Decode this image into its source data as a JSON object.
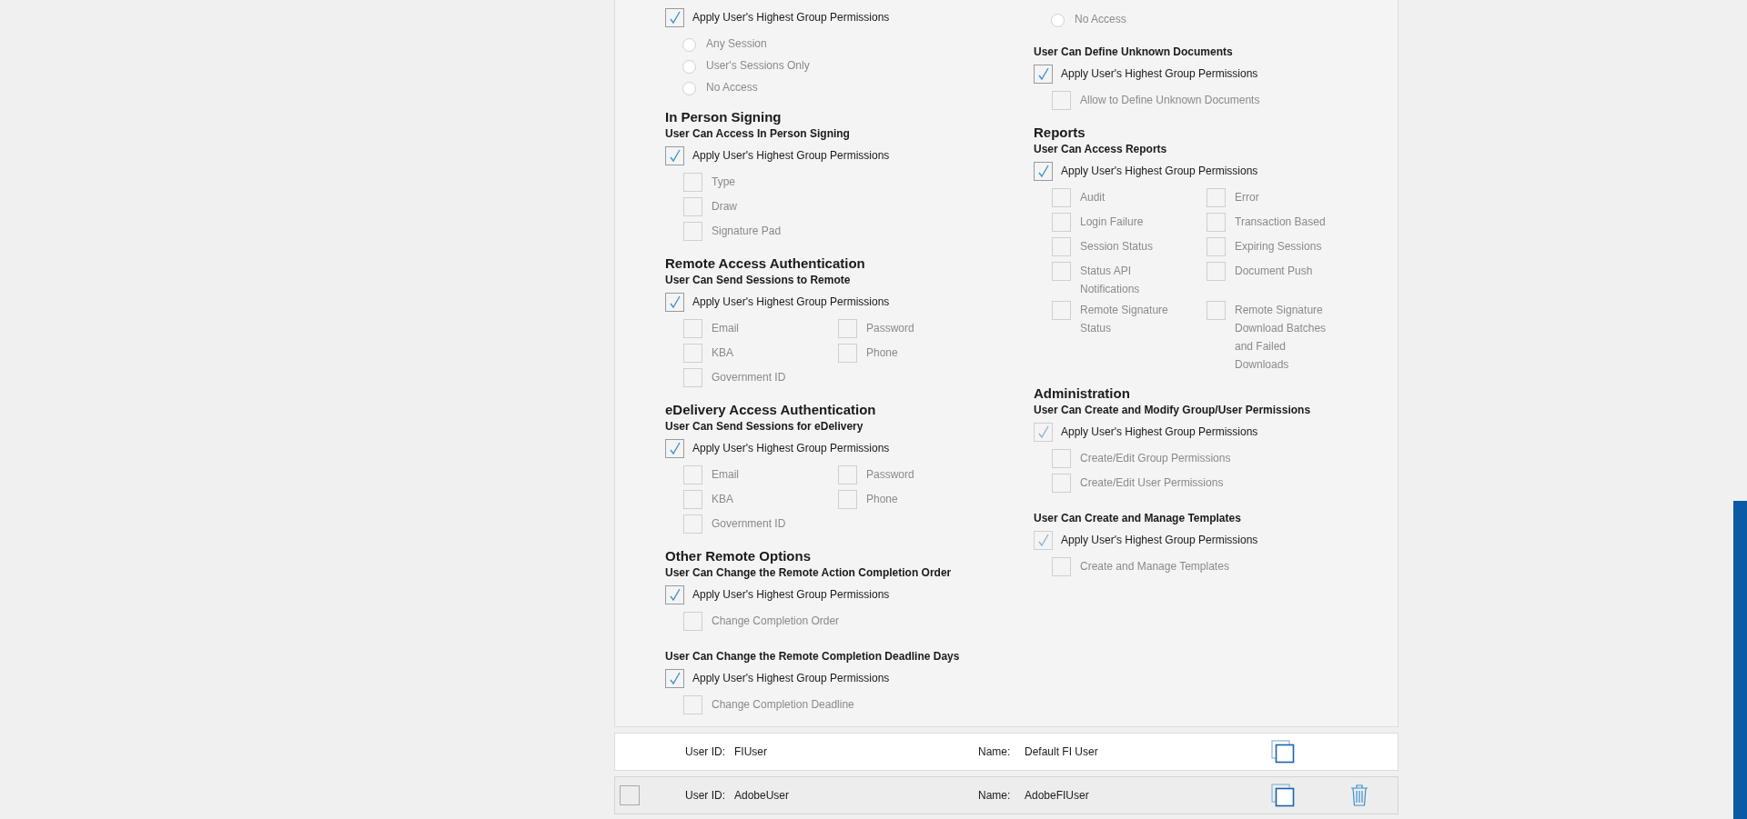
{
  "columns": [
    {
      "items": [
        {
          "kind": "permission",
          "apply": {
            "label": "Apply User's Highest Group Permissions",
            "checked": true,
            "disabled": false
          },
          "options": {
            "kind": "list",
            "items": [
              {
                "kind": "radio",
                "label": "Any Session",
                "selected": false
              },
              {
                "kind": "radio",
                "label": "User's Sessions Only",
                "selected": false
              },
              {
                "kind": "radio",
                "label": "No Access",
                "selected": false
              }
            ]
          }
        },
        {
          "kind": "heading",
          "text": "In Person Signing"
        },
        {
          "kind": "permission",
          "title": "User Can Access In Person Signing",
          "apply": {
            "label": "Apply User's Highest Group Permissions",
            "checked": true,
            "disabled": false
          },
          "options": {
            "kind": "list",
            "items": [
              {
                "kind": "checkbox",
                "label": "Type",
                "checked": false
              },
              {
                "kind": "checkbox",
                "label": "Draw",
                "checked": false
              },
              {
                "kind": "checkbox",
                "label": "Signature Pad",
                "checked": false
              }
            ]
          }
        },
        {
          "kind": "heading",
          "text": "Remote Access Authentication"
        },
        {
          "kind": "permission",
          "title": "User Can Send Sessions to Remote",
          "apply": {
            "label": "Apply User's Highest Group Permissions",
            "checked": true,
            "disabled": false
          },
          "options": {
            "kind": "grid",
            "items": [
              {
                "kind": "checkbox",
                "label": "Email",
                "checked": false
              },
              {
                "kind": "checkbox",
                "label": "Password",
                "checked": false
              },
              {
                "kind": "checkbox",
                "label": "KBA",
                "checked": false
              },
              {
                "kind": "checkbox",
                "label": "Phone",
                "checked": false
              },
              {
                "kind": "checkbox",
                "label": "Government ID",
                "checked": false
              }
            ]
          }
        },
        {
          "kind": "heading",
          "text": "eDelivery Access Authentication"
        },
        {
          "kind": "permission",
          "title": "User Can Send Sessions for eDelivery",
          "apply": {
            "label": "Apply User's Highest Group Permissions",
            "checked": true,
            "disabled": false
          },
          "options": {
            "kind": "grid",
            "items": [
              {
                "kind": "checkbox",
                "label": "Email",
                "checked": false
              },
              {
                "kind": "checkbox",
                "label": "Password",
                "checked": false
              },
              {
                "kind": "checkbox",
                "label": "KBA",
                "checked": false
              },
              {
                "kind": "checkbox",
                "label": "Phone",
                "checked": false
              },
              {
                "kind": "checkbox",
                "label": "Government ID",
                "checked": false
              }
            ]
          }
        },
        {
          "kind": "heading",
          "text": "Other Remote Options"
        },
        {
          "kind": "permission",
          "title": "User Can Change the Remote Action Completion Order",
          "apply": {
            "label": "Apply User's Highest Group Permissions",
            "checked": true,
            "disabled": false
          },
          "options": {
            "kind": "list",
            "items": [
              {
                "kind": "checkbox",
                "label": "Change Completion Order",
                "checked": false
              }
            ]
          }
        },
        {
          "kind": "permission",
          "title": "User Can Change the Remote Completion Deadline Days",
          "apply": {
            "label": "Apply User's Highest Group Permissions",
            "checked": true,
            "disabled": false
          },
          "options": {
            "kind": "list",
            "items": [
              {
                "kind": "checkbox",
                "label": "Change Completion Deadline",
                "checked": false
              }
            ]
          }
        }
      ]
    },
    {
      "items": [
        {
          "kind": "permission",
          "options": {
            "kind": "list",
            "items": [
              {
                "kind": "radio",
                "label": "No Access",
                "selected": false
              }
            ]
          }
        },
        {
          "kind": "permission",
          "title": "User Can Define Unknown Documents",
          "apply": {
            "label": "Apply User's Highest Group Permissions",
            "checked": true,
            "disabled": false
          },
          "options": {
            "kind": "list",
            "items": [
              {
                "kind": "checkbox",
                "label": "Allow to Define Unknown Documents",
                "checked": false
              }
            ]
          }
        },
        {
          "kind": "heading",
          "text": "Reports"
        },
        {
          "kind": "permission",
          "title": "User Can Access Reports",
          "apply": {
            "label": "Apply User's Highest Group Permissions",
            "checked": true,
            "disabled": false
          },
          "options": {
            "kind": "grid",
            "items": [
              {
                "kind": "checkbox",
                "label": "Audit",
                "checked": false
              },
              {
                "kind": "checkbox",
                "label": "Error",
                "checked": false
              },
              {
                "kind": "checkbox",
                "label": "Login Failure",
                "checked": false
              },
              {
                "kind": "checkbox",
                "label": "Transaction Based",
                "checked": false
              },
              {
                "kind": "checkbox",
                "label": "Session Status",
                "checked": false
              },
              {
                "kind": "checkbox",
                "label": "Expiring Sessions",
                "checked": false
              },
              {
                "kind": "checkbox",
                "label": "Status API Notifications",
                "checked": false
              },
              {
                "kind": "checkbox",
                "label": "Document Push",
                "checked": false
              },
              {
                "kind": "checkbox",
                "label": "Remote Signature Status",
                "checked": false
              },
              {
                "kind": "checkbox",
                "label": "Remote Signature Download Batches and Failed Downloads",
                "checked": false
              }
            ]
          }
        },
        {
          "kind": "heading",
          "text": "Administration"
        },
        {
          "kind": "permission",
          "title": "User Can Create and Modify Group/User Permissions",
          "apply": {
            "label": "Apply User's Highest Group Permissions",
            "checked": true,
            "disabled": true
          },
          "options": {
            "kind": "list",
            "items": [
              {
                "kind": "checkbox",
                "label": "Create/Edit Group Permissions",
                "checked": false
              },
              {
                "kind": "checkbox",
                "label": "Create/Edit User Permissions",
                "checked": false
              }
            ]
          }
        },
        {
          "kind": "permission",
          "title": "User Can Create and Manage Templates",
          "apply": {
            "label": "Apply User's Highest Group Permissions",
            "checked": true,
            "disabled": true
          },
          "options": {
            "kind": "list",
            "items": [
              {
                "kind": "checkbox",
                "label": "Create and Manage Templates",
                "checked": false
              }
            ]
          }
        }
      ]
    }
  ],
  "users": [
    {
      "selected": true,
      "deletable": false,
      "id_label": "User ID:",
      "id": "FIUser",
      "name_label": "Name:",
      "name": "Default FI User"
    },
    {
      "selected": false,
      "deletable": true,
      "checkbox": {
        "checked": false
      },
      "id_label": "User ID:",
      "id": "AdobeUser",
      "name_label": "Name:",
      "name": "AdobeFIUser"
    }
  ]
}
